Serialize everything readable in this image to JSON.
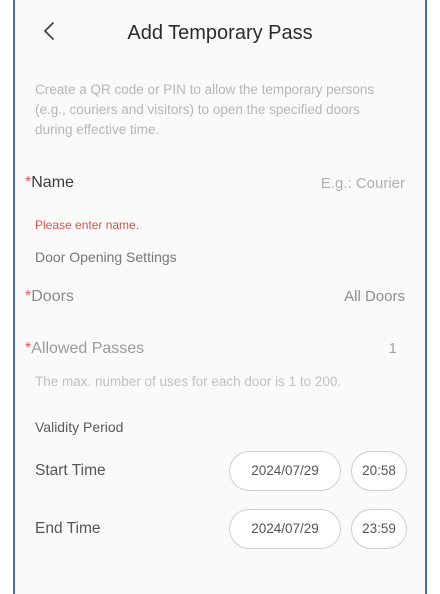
{
  "header": {
    "title": "Add Temporary Pass",
    "back_icon": "chevron-left-icon"
  },
  "description": "Create a QR code or PIN to allow the temporary persons (e.g., couriers and visitors) to open the specified doors during effective time.",
  "form": {
    "name": {
      "required_mark": "*",
      "label": "Name",
      "placeholder": "E.g.: Courier",
      "error": "Please enter name."
    },
    "door_settings_title": "Door Opening Settings",
    "doors": {
      "required_mark": "*",
      "label": "Doors",
      "value": "All Doors"
    },
    "allowed_passes": {
      "required_mark": "*",
      "label": "Allowed Passes",
      "value": "1",
      "hint": "The max. number of uses for each door is 1 to 200."
    },
    "validity_title": "Validity Period",
    "start_time": {
      "label": "Start Time",
      "date": "2024/07/29",
      "time": "20:58"
    },
    "end_time": {
      "label": "End Time",
      "date": "2024/07/29",
      "time": "23:59"
    }
  },
  "colors": {
    "required_mark": "#e05a5a",
    "error_text": "#d9534f",
    "frame_border": "#3a6fb0"
  }
}
